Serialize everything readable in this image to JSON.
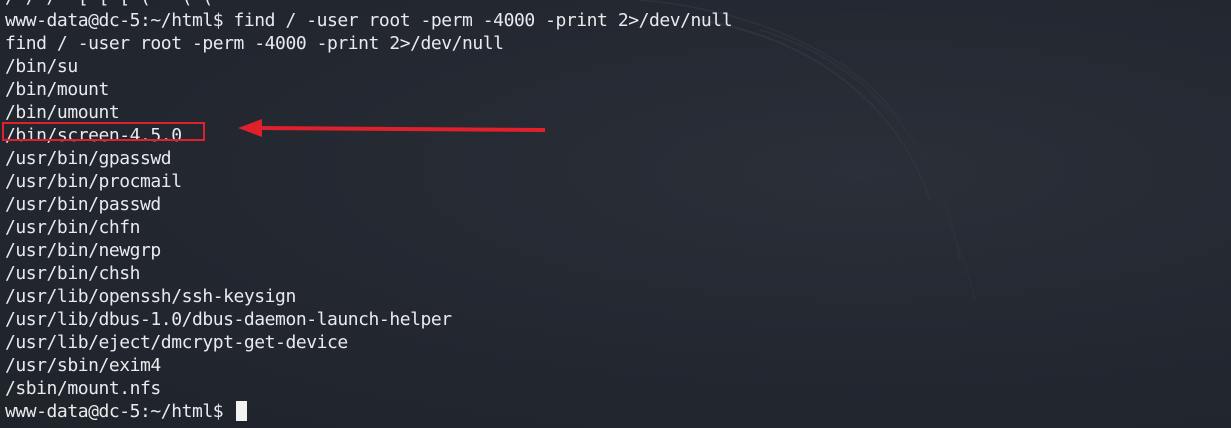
{
  "terminal": {
    "lines": [
      "/ / /  [ [ [ (   ( (",
      "www-data@dc-5:~/html$ find / -user root -perm -4000 -print 2>/dev/null",
      "find / -user root -perm -4000 -print 2>/dev/null",
      "/bin/su",
      "/bin/mount",
      "/bin/umount",
      "/bin/screen-4.5.0",
      "/usr/bin/gpasswd",
      "/usr/bin/procmail",
      "/usr/bin/passwd",
      "/usr/bin/chfn",
      "/usr/bin/newgrp",
      "/usr/bin/chsh",
      "/usr/lib/openssh/ssh-keysign",
      "/usr/lib/dbus-1.0/dbus-daemon-launch-helper",
      "/usr/lib/eject/dmcrypt-get-device",
      "/usr/sbin/exim4",
      "/sbin/mount.nfs"
    ],
    "prompt": "www-data@dc-5:~/html$ "
  },
  "annotation": {
    "color": "#e0202b",
    "target": "/bin/screen-4.5.0"
  },
  "colors": {
    "background": "#22262e",
    "text": "#e8eaed"
  }
}
